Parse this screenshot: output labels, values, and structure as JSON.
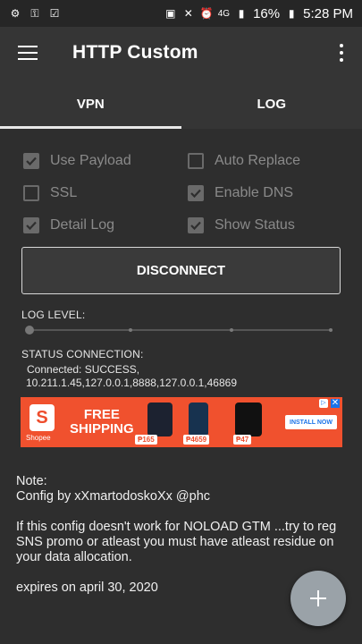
{
  "status_bar": {
    "battery": "16%",
    "time": "5:28 PM",
    "network": "4G"
  },
  "app_bar": {
    "title": "HTTP Custom"
  },
  "tabs": [
    {
      "label": "VPN",
      "active": true
    },
    {
      "label": "LOG",
      "active": false
    }
  ],
  "options": {
    "use_payload": {
      "label": "Use Payload",
      "checked": true
    },
    "auto_replace": {
      "label": "Auto Replace",
      "checked": false
    },
    "ssl": {
      "label": "SSL",
      "checked": false
    },
    "enable_dns": {
      "label": "Enable DNS",
      "checked": true
    },
    "detail_log": {
      "label": "Detail Log",
      "checked": true
    },
    "show_status": {
      "label": "Show Status",
      "checked": true
    }
  },
  "disconnect_button": {
    "label": "DISCONNECT"
  },
  "log_level": {
    "label": "LOG LEVEL:",
    "value": 0
  },
  "status_connection": {
    "label": "STATUS CONNECTION:",
    "line1": "Connected: SUCCESS,",
    "line2": "10.211.1.45,127.0.0.1,8888,127.0.0.1,46869"
  },
  "ad": {
    "brand": "Shopee",
    "headline_line1": "FREE",
    "headline_line2": "SHIPPING",
    "prices": [
      "₱165",
      "₱4659",
      "₱47"
    ],
    "cta": "INSTALL NOW"
  },
  "note": {
    "title": "Note:",
    "config": "Config by xXmartodoskoXx @phc",
    "body": "If this config doesn't work for NOLOAD GTM ...try to reg SNS promo or atleast you must have atleast residue on your data allocation.",
    "expires": "expires on april 30, 2020"
  },
  "colors": {
    "background": "#2e2e2e",
    "appbar": "#353535",
    "ad_orange": "#f0512e",
    "fab": "#9aa2a8"
  }
}
